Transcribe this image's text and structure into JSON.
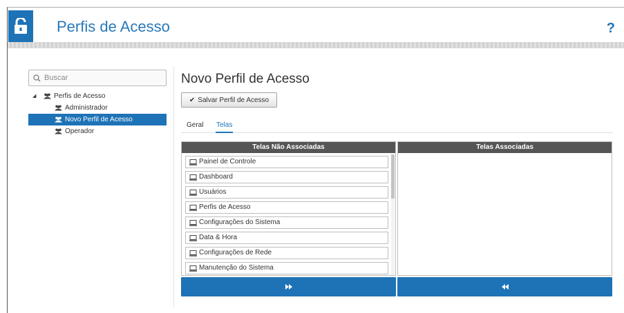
{
  "header": {
    "title": "Perfis de Acesso",
    "help_label": "?",
    "icons": {
      "app": "lock-open-icon",
      "help": "question-icon"
    }
  },
  "sidebar": {
    "search": {
      "placeholder": "Buscar"
    },
    "tree": {
      "root": {
        "label": "Perfis de Acesso",
        "expanded": true
      },
      "children": [
        {
          "label": "Administrador",
          "selected": false
        },
        {
          "label": "Novo Perfil de Acesso",
          "selected": true
        },
        {
          "label": "Operador",
          "selected": false
        }
      ]
    }
  },
  "main": {
    "title": "Novo Perfil de Acesso",
    "save_label": "Salvar Perfil de Acesso",
    "tabs": [
      {
        "label": "Geral",
        "active": false
      },
      {
        "label": "Telas",
        "active": true
      }
    ],
    "unassigned": {
      "header": "Telas Não Associadas",
      "items": [
        "Painel de Controle",
        "Dashboard",
        "Usuários",
        "Perfis de Acesso",
        "Configurações do Sistema",
        "Data & Hora",
        "Configurações de Rede",
        "Manutenção do Sistema"
      ],
      "move_button_icon": "double-chevron-right-icon"
    },
    "assigned": {
      "header": "Telas Associadas",
      "items": [],
      "move_button_icon": "double-chevron-left-icon"
    }
  },
  "colors": {
    "accent": "#1e73b7",
    "panel_header": "#555555",
    "title_text": "#2a78b8"
  }
}
